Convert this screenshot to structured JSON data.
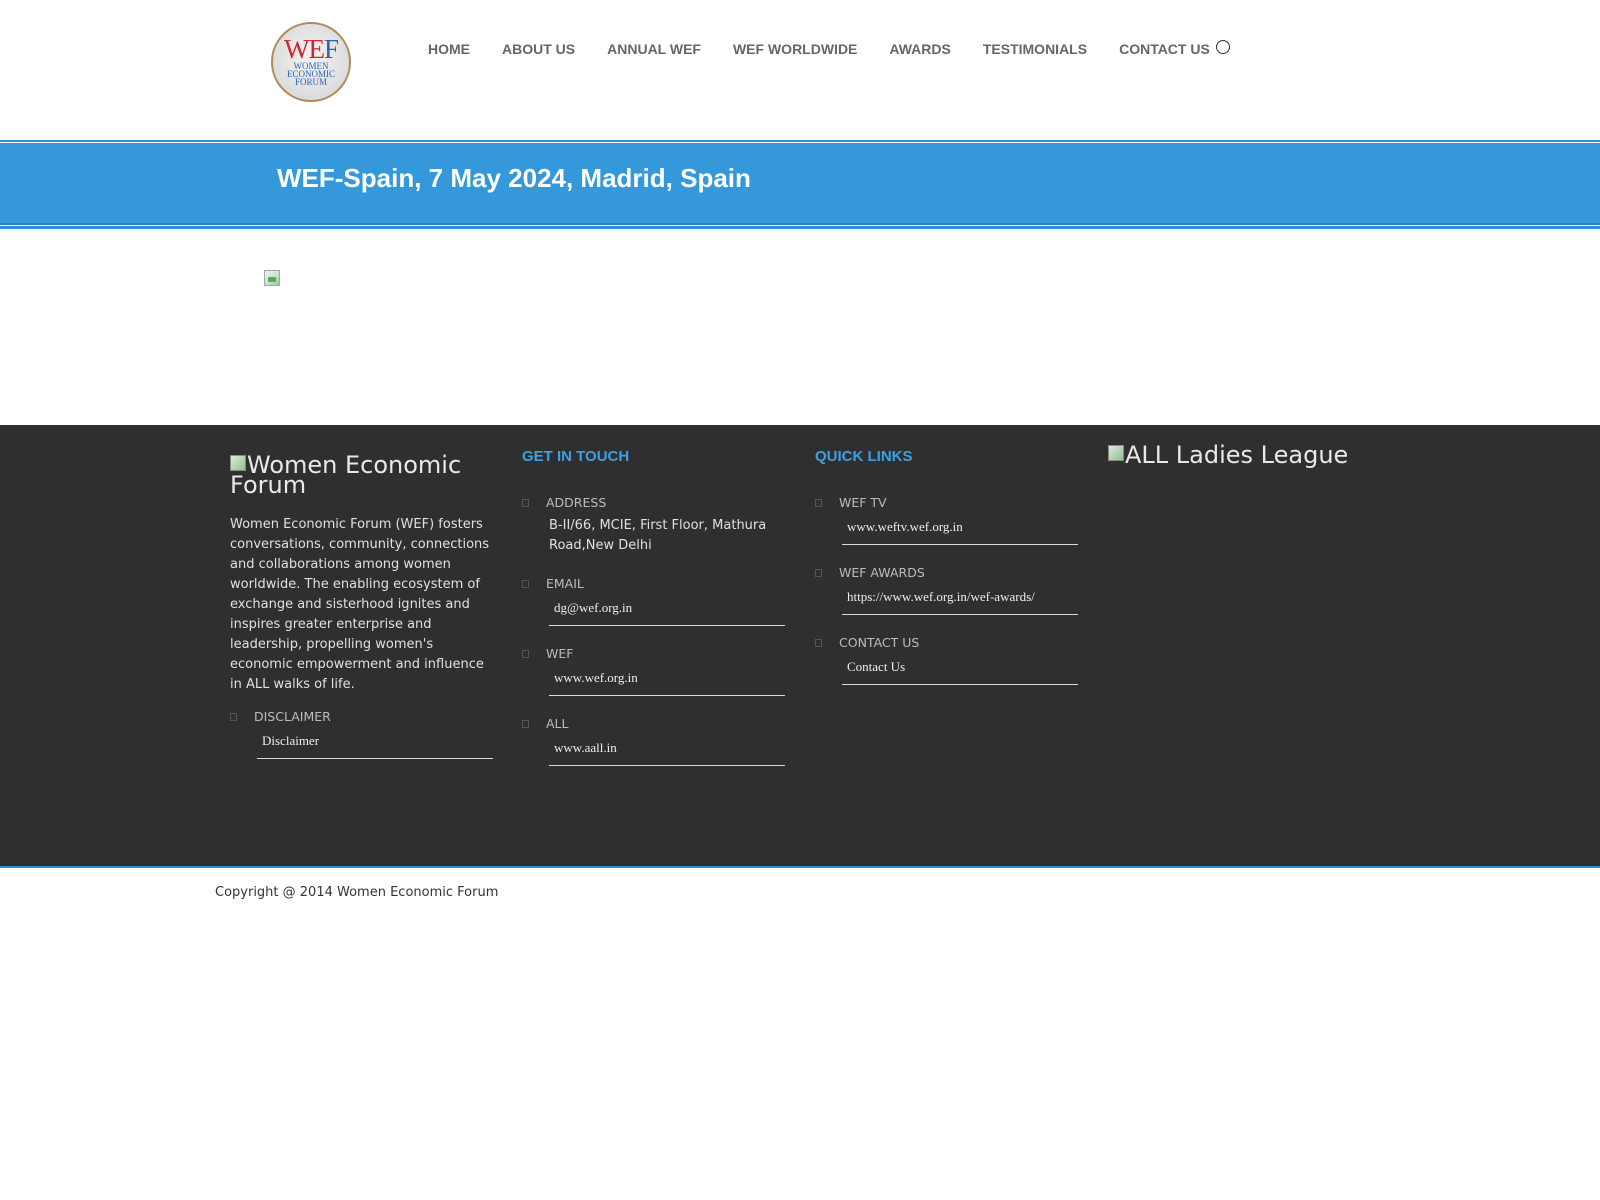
{
  "header": {
    "logo": {
      "main_w": "W",
      "main_e": "E",
      "main_f": "F",
      "line1": "WOMEN",
      "line2": "ECONOMIC",
      "line3": "FORUM"
    },
    "nav": [
      "HOME",
      "ABOUT US",
      "ANNUAL WEF",
      "WEF WORLDWIDE",
      "AWARDS",
      "TESTIMONIALS",
      "CONTACT US"
    ],
    "search_icon": "search-icon"
  },
  "banner": {
    "title": "WEF-Spain, 7 May 2024, Madrid, Spain"
  },
  "footer": {
    "logo_alt": "Women Economic Forum",
    "about": "Women Economic Forum (WEF) fosters conversations, community, connections and collaborations among women worldwide. The enabling ecosystem of exchange and sisterhood ignites and inspires greater enterprise and leadership, propelling women's economic empowerment and influence in ALL walks of life.",
    "disclaimer": {
      "label": "DISCLAIMER",
      "link": "Disclaimer"
    },
    "get_in_touch": {
      "heading": "GET IN TOUCH",
      "address": {
        "label": "ADDRESS",
        "value": "B-II/66, MCIE, First Floor, Mathura Road,New Delhi"
      },
      "email": {
        "label": "EMAIL",
        "link": "dg@wef.org.in"
      },
      "wef": {
        "label": "WEF",
        "link": "www.wef.org.in"
      },
      "all": {
        "label": "ALL",
        "link": "www.aall.in"
      }
    },
    "quick_links": {
      "heading": "QUICK LINKS",
      "wef_tv": {
        "label": "WEF TV",
        "link": "www.weftv.wef.org.in"
      },
      "wef_awards": {
        "label": "WEF AWARDS",
        "link": "https://www.wef.org.in/wef-awards/"
      },
      "contact": {
        "label": "CONTACT US",
        "link": "Contact Us"
      }
    },
    "ladies_alt": "ALL Ladies League"
  },
  "copyright": "Copyright @ 2014 Women Economic Forum",
  "colors": {
    "accent": "#3498db",
    "footer_bg": "#2f2f2f",
    "heading_blue": "#3da0e6"
  }
}
